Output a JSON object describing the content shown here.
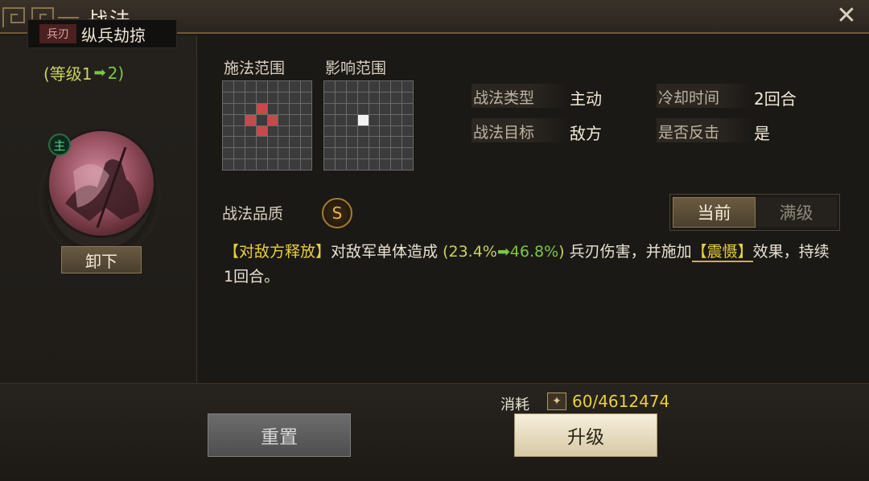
{
  "window": {
    "title": "战法"
  },
  "skill": {
    "type_tag": "兵刃",
    "name": "纵兵劫掠",
    "level_prefix": "(等级1",
    "level_to": "2)",
    "unequip_label": "卸下",
    "main_badge": "主"
  },
  "ranges": {
    "cast_label": "施法范围",
    "effect_label": "影响范围"
  },
  "info": {
    "type_label": "战法类型",
    "type_value": "主动",
    "cooldown_label": "冷却时间",
    "cooldown_value": "2回合",
    "target_label": "战法目标",
    "target_value": "敌方",
    "counter_label": "是否反击",
    "counter_value": "是"
  },
  "quality": {
    "label": "战法品质",
    "grade": "S"
  },
  "toggle": {
    "current": "当前",
    "max": "满级"
  },
  "description": {
    "trigger": "【对敌方释放】",
    "part1": "对敌军单体造成",
    "open_paren": "(",
    "value_from": "23.4%",
    "value_to": "46.8%",
    "close_paren": ")",
    "part2": "兵刃伤害，并施加",
    "status": "【震慑】",
    "part3": "效果，持续1回合。"
  },
  "footer": {
    "cost_label": "消耗",
    "cost_icon": "scroll-icon",
    "cost_value": "60/4612474",
    "reset_label": "重置",
    "upgrade_label": "升级"
  }
}
